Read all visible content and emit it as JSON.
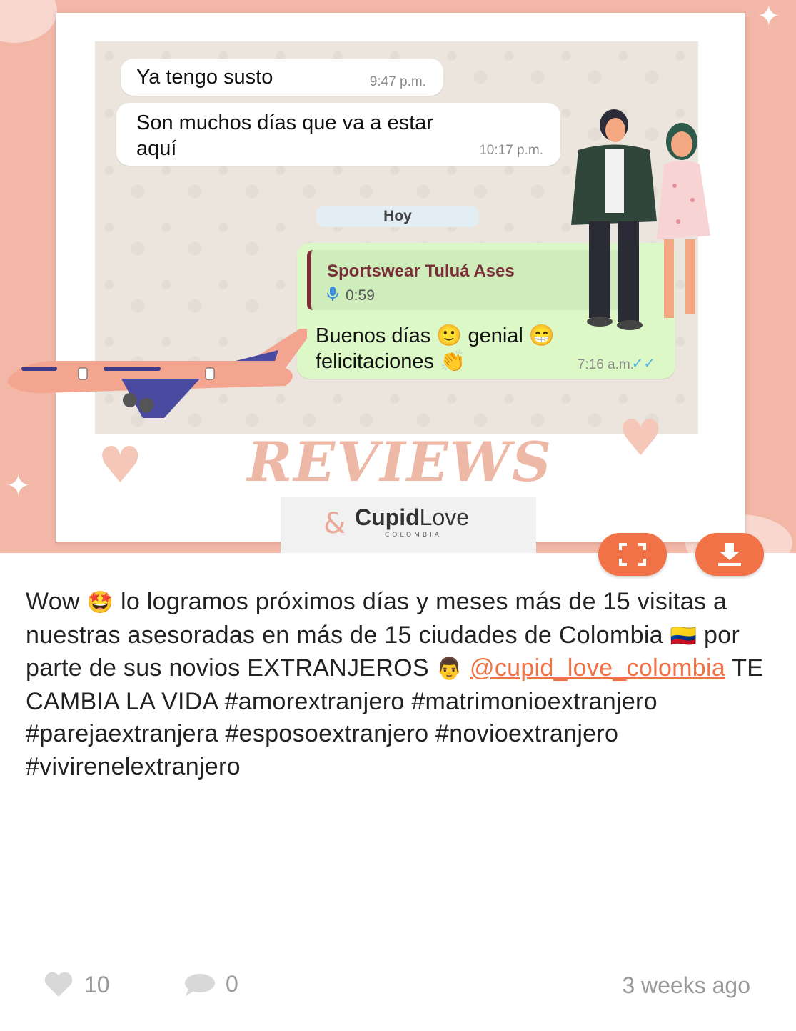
{
  "post_image": {
    "chat": {
      "messages": [
        {
          "text": "Ya tengo susto",
          "time": "9:47 p.m."
        },
        {
          "text": "Son muchos días que va a estar\naquí",
          "time": "10:17 p.m."
        }
      ],
      "day_divider": "Hoy",
      "reply": {
        "quoted_name": "Sportswear Tuluá Ases",
        "quoted_icon": "mic-icon",
        "quoted_duration": "0:59",
        "text": "Buenos días 🙂 genial 😁\nfelicitaciones 👏",
        "time": "7:16 a.m.",
        "ticks": "✓✓"
      }
    },
    "banner_title": "REVIEWS",
    "logo": {
      "brand_a": "Cupid",
      "brand_b": "Love",
      "sub": "COLOMBIA"
    }
  },
  "actions": {
    "expand_icon": "fullscreen-icon",
    "download_icon": "download-icon",
    "accent": "#f07246"
  },
  "caption": {
    "part1": "Wow ",
    "emoji1": "🤩",
    "part2": " lo logramos próximos días y meses más de 15 visitas a nuestras asesoradas en más de 15 ciudades de Colombia ",
    "emoji2": "🇨🇴",
    "part3": " por parte de sus novios EXTRANJEROS ",
    "emoji3": "👨",
    "mention": "@cupid_love_colombia",
    "part4": " TE CAMBIA LA VIDA #amorextranjero #matrimonioextranjero #parejaextranjera #esposoextranjero #novioextranjero #vivirenelextranjero"
  },
  "footer": {
    "likes": "10",
    "comments": "0",
    "time_ago": "3 weeks ago"
  }
}
